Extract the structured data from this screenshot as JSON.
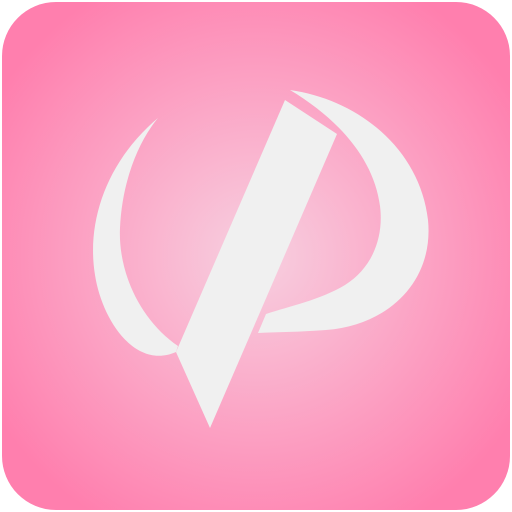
{
  "icon": {
    "name": "vp-app-icon",
    "colors": {
      "background_edge": "#FF7FAE",
      "background_center": "#F7D0E0",
      "glyph": "#F0F0F0"
    },
    "glyph_icon": "vp-monogram-icon"
  }
}
